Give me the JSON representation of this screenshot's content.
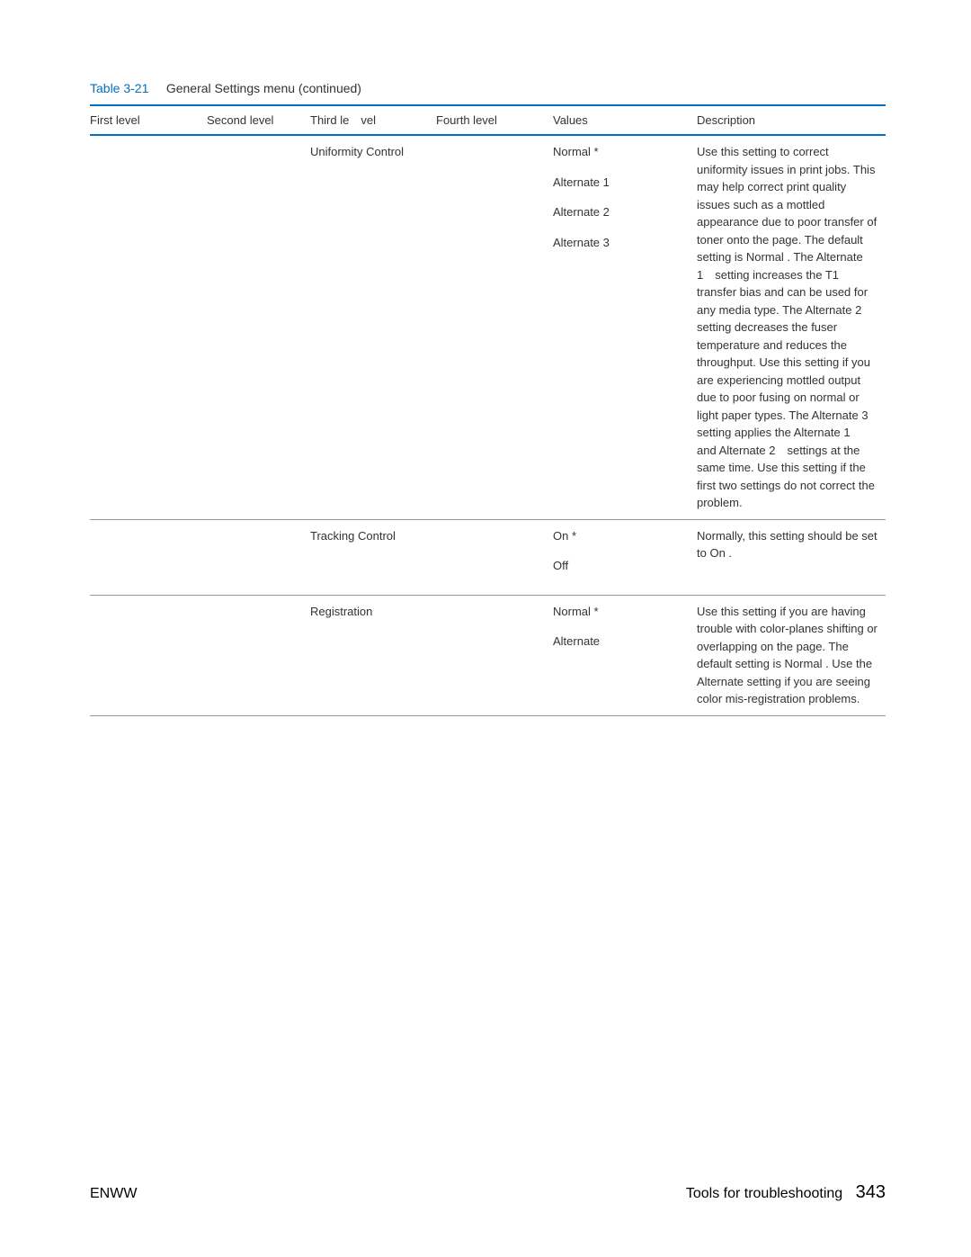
{
  "title": {
    "table_number": "Table 3-21",
    "table_name": "General Settings menu (continued)"
  },
  "headers": {
    "col1": "First level",
    "col2": "Second level",
    "col3": "Third le vel",
    "col4": "Fourth level",
    "col5": "Values",
    "col6": "Description"
  },
  "rows": [
    {
      "col1": "",
      "col2": "",
      "col3": "Uniformity Control",
      "col4": "",
      "values": [
        "Normal  *",
        "Alternate 1",
        "Alternate 2",
        "Alternate 3"
      ],
      "description": "Use this setting to correct uniformity issues in print jobs. This may help correct print quality issues such as a mottled appearance due to poor transfer of toner onto the page. The default setting is Normal  . The Alternate 1 setting increases the T1 transfer bias and can be used for any media type. The Alternate 2 setting decreases the fuser temperature and reduces the throughput. Use this setting if you are experiencing mottled output due to poor fusing on normal or light paper types. The Alternate 3 setting applies the Alternate 1 and Alternate 2 settings at the same time. Use this setting if the first two settings do not correct the problem."
    },
    {
      "col1": "",
      "col2": "",
      "col3": "Tracking Control",
      "col4": "",
      "values": [
        "On *",
        "Off"
      ],
      "description": "Normally, this setting should be set to On ."
    },
    {
      "col1": "",
      "col2": "",
      "col3": "Registration",
      "col4": "",
      "values": [
        "Normal  *",
        "Alternate"
      ],
      "description": "Use this setting if you are having trouble with color-planes shifting or overlapping on the page. The default setting is Normal  . Use the Alternate setting if you are seeing color mis-registration problems."
    }
  ],
  "footer": {
    "left": "ENWW",
    "right_label": "Tools for troubleshooting",
    "page_number": "343"
  }
}
